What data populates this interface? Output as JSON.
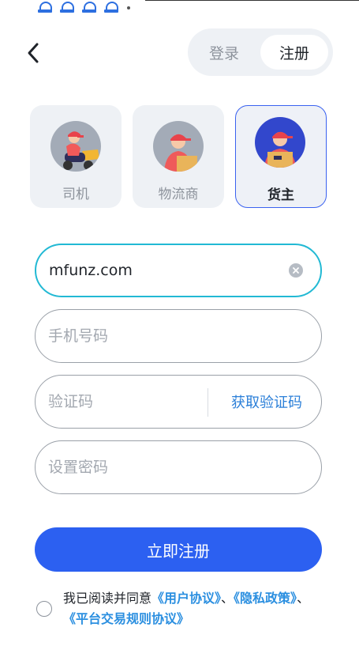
{
  "status_bar": {
    "icons": [
      "status-app-icon",
      "status-app-icon",
      "status-app-icon",
      "status-app-icon"
    ]
  },
  "header": {
    "back_icon": "chevron-left-icon",
    "tabs": {
      "login": "登录",
      "register": "注册",
      "active": "register"
    }
  },
  "roles": [
    {
      "label": "司机",
      "selected": false
    },
    {
      "label": "物流商",
      "selected": false
    },
    {
      "label": "货主",
      "selected": true
    }
  ],
  "form": {
    "account": {
      "value": "mfunz.com",
      "clear_icon": "clear-circle-icon"
    },
    "phone": {
      "placeholder": "手机号码"
    },
    "code": {
      "placeholder": "验证码",
      "button_label": "获取验证码"
    },
    "password": {
      "placeholder": "设置密码"
    }
  },
  "submit_label": "立即注册",
  "agreement": {
    "prefix": "我已阅读并同意",
    "link_user": "《用户协议》",
    "separator1": "、",
    "link_privacy": "《隐私政策》",
    "separator2": "、",
    "link_rules": "《平台交易规则协议》",
    "checked": false
  },
  "colors": {
    "accent": "#2c60f1",
    "input_focus": "#22b9d4",
    "link": "#2b8fe0",
    "card_bg": "#eef1f5"
  }
}
